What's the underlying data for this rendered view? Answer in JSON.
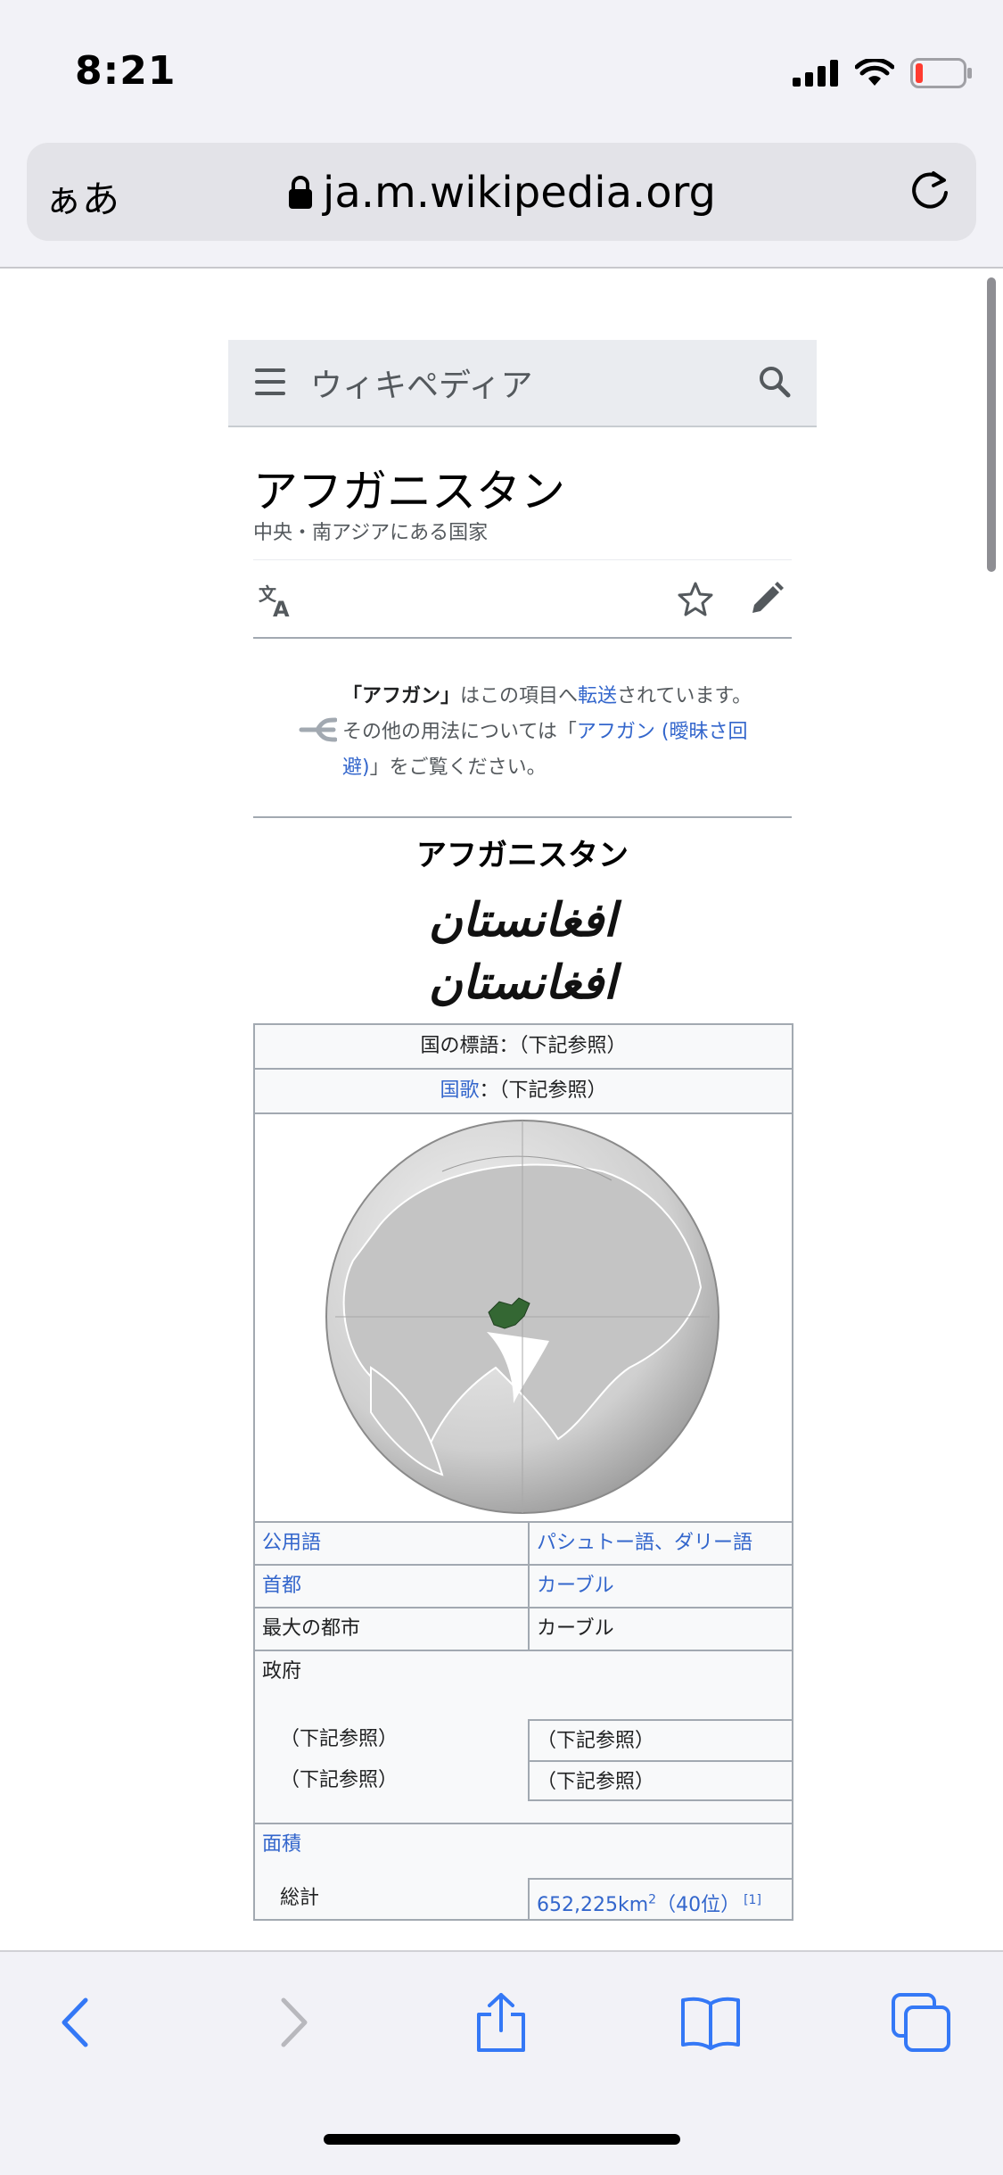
{
  "status_bar": {
    "time": "8:21"
  },
  "safari": {
    "text_size_label": "ぁあ",
    "domain": "ja.m.wikipedia.org"
  },
  "wiki_header": {
    "site_title": "ウィキペディア"
  },
  "article": {
    "title": "アフガニスタン",
    "description": "中央・南アジアにある国家"
  },
  "hatnote": {
    "part1_bold": "「アフガン」",
    "part2": "はこの項目へ",
    "link1": "転送",
    "part3": "されています。その他の用法については「",
    "link2": "アフガン (曖昧さ回避)",
    "part4": "」をご覧ください。"
  },
  "infobox": {
    "title": "アフガニスタン",
    "native_name_1": "افغانستان",
    "native_name_2": "افغانستان",
    "motto": "国の標語：（下記参照）",
    "anthem_link": "国歌",
    "anthem_rest": "：（下記参照）",
    "rows": [
      {
        "key": "公用語",
        "key_link": true,
        "value": "パシュトー語、ダリー語",
        "value_link": true
      },
      {
        "key": "首都",
        "key_link": true,
        "value": "カーブル",
        "value_link": true
      },
      {
        "key": "最大の都市",
        "key_link": false,
        "value": "カーブル",
        "value_link": false
      }
    ],
    "government_label": "政府",
    "government_rows": [
      {
        "key": "（下記参照）",
        "value": "（下記参照）"
      },
      {
        "key": "（下記参照）",
        "value": "（下記参照）"
      }
    ],
    "area_label": "面積",
    "area_total_label": "総計",
    "area_total_value": "652,225km",
    "area_superscript": "2",
    "area_rank": "（40位）",
    "area_ref": "[1]"
  },
  "colors": {
    "link": "#3366cc",
    "afghanistan_highlight": "#346733"
  }
}
